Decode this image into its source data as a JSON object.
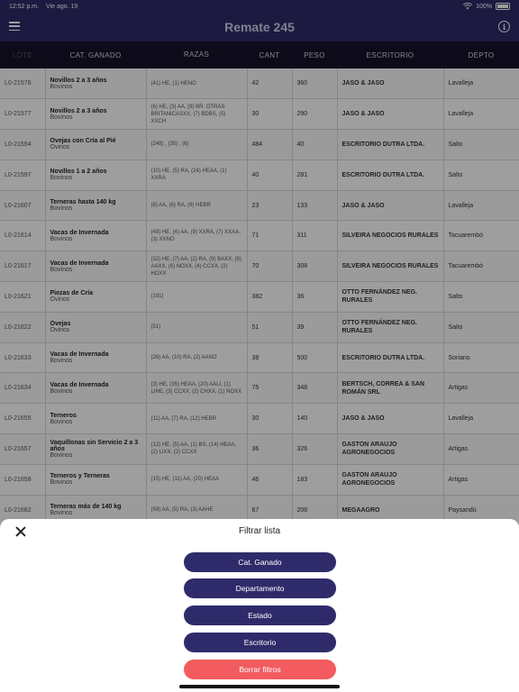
{
  "status": {
    "time": "12:52 p.m.",
    "date": "Vie ago. 19",
    "battery": "100%"
  },
  "header": {
    "title": "Remate 245"
  },
  "table": {
    "columns": [
      "LOTE",
      "CAT. GANADO",
      "RAZAS",
      "CANT",
      "PESO",
      "ESCRITORIO",
      "DEPTO"
    ],
    "rows": [
      {
        "lote": "L0-21576",
        "cat": "Novillos 2 a 3 años",
        "tipo": "Bovinos",
        "razas": "(41) HE, (1) HENO",
        "cant": "42",
        "peso": "360",
        "escritorio": "JASO & JASO",
        "depto": "Lavalleja"
      },
      {
        "lote": "L0-21577",
        "cat": "Novillos 2 a 3 años",
        "tipo": "Bovinos",
        "razas": "(6) HE, (3) AA, (9) BR: OTRAS BRITANICASXX, (7) BDBS, (5) XXCH",
        "cant": "30",
        "peso": "290",
        "escritorio": "JASO & JASO",
        "depto": "Lavalleja"
      },
      {
        "lote": "L0-21594",
        "cat": "Ovejas con Cría al Pié",
        "tipo": "Ovinos",
        "razas": "(248) , (35) , (6)",
        "cant": "484",
        "peso": "40",
        "escritorio": "ESCRITORIO DUTRA LTDA.",
        "depto": "Salto"
      },
      {
        "lote": "L0-21597",
        "cat": "Novillos 1 a 2 años",
        "tipo": "Bovinos",
        "razas": "(10) HE, (5) RA, (24) HEAA, (1) XXRA",
        "cant": "40",
        "peso": "281",
        "escritorio": "ESCRITORIO DUTRA LTDA.",
        "depto": "Salto"
      },
      {
        "lote": "L0-21607",
        "cat": "Terneras hasta 140 kg",
        "tipo": "Bovinos",
        "razas": "(8) AA, (6) RA, (9) HEBR",
        "cant": "23",
        "peso": "133",
        "escritorio": "JASO & JASO",
        "depto": "Lavalleja"
      },
      {
        "lote": "L0-21614",
        "cat": "Vacas de Invernada",
        "tipo": "Bovinos",
        "razas": "(48) HE, (4) AA, (9) XXRA, (7) XXAA, (3) XXNO",
        "cant": "71",
        "peso": "311",
        "escritorio": "SILVEIRA NEGOCIOS RURALES",
        "depto": "Tacuarembó"
      },
      {
        "lote": "L0-21617",
        "cat": "Vacas de Invernada",
        "tipo": "Bovinos",
        "razas": "(32) HE, (7) AA, (2) RA, (9) BAXX, (8) AAXX, (6) NOXX, (4) CCXX, (2) HOXX",
        "cant": "70",
        "peso": "308",
        "escritorio": "SILVEIRA NEGOCIOS RURALES",
        "depto": "Tacuarembó"
      },
      {
        "lote": "L0-21621",
        "cat": "Piezas de Cría",
        "tipo": "Ovinos",
        "razas": "(191)",
        "cant": "382",
        "peso": "36",
        "escritorio": "OTTO FERNÁNDEZ NEG. RURALES",
        "depto": "Salto"
      },
      {
        "lote": "L0-21622",
        "cat": "Ovejas",
        "tipo": "Ovinos",
        "razas": "(51)",
        "cant": "51",
        "peso": "39",
        "escritorio": "OTTO FERNÁNDEZ NEG. RURALES",
        "depto": "Salto"
      },
      {
        "lote": "L0-21633",
        "cat": "Vacas de Invernada",
        "tipo": "Bovinos",
        "razas": "(26) AA, (10) RA, (2) AANO",
        "cant": "38",
        "peso": "500",
        "escritorio": "ESCRITORIO DUTRA LTDA.",
        "depto": "Soriano"
      },
      {
        "lote": "L0-21634",
        "cat": "Vacas de Invernada",
        "tipo": "Bovinos",
        "razas": "(3) HE, (35) HEAA, (20) AALI, (1) LIHE, (3) CCXX, (2) CHXX, (1) NOXX",
        "cant": "75",
        "peso": "348",
        "escritorio": "BERTSCH, CORREA & SAN ROMÁN SRL",
        "depto": "Artigas"
      },
      {
        "lote": "L0-21655",
        "cat": "Terneros",
        "tipo": "Bovinos",
        "razas": "(11) AA, (7) RA, (12) HEBR",
        "cant": "30",
        "peso": "140",
        "escritorio": "JASO & JASO",
        "depto": "Lavalleja"
      },
      {
        "lote": "L0-21657",
        "cat": "Vaquillonas sin Servicio 2 a 3 años",
        "tipo": "Bovinos",
        "razas": "(12) HE, (5) AA, (1) BS, (14) HEAA, (2) LIXX, (2) CCXX",
        "cant": "36",
        "peso": "326",
        "escritorio": "GASTON ARAUJO AGRONEGOCIOS",
        "depto": "Artigas"
      },
      {
        "lote": "L0-21658",
        "cat": "Terneros y Terneras",
        "tipo": "Bovinos",
        "razas": "(15) HE, (11) AA, (20) HEAA",
        "cant": "46",
        "peso": "183",
        "escritorio": "GASTON ARAUJO AGRONEGOCIOS",
        "depto": "Artigas"
      },
      {
        "lote": "L0-21682",
        "cat": "Terneras más de 140 kg",
        "tipo": "Bovinos",
        "razas": "(59) AA, (5) RA, (3) AAHE",
        "cant": "67",
        "peso": "208",
        "escritorio": "MEGAAGRO",
        "depto": "Paysandú"
      }
    ]
  },
  "filter_sheet": {
    "title": "Filtrar lista",
    "buttons": [
      "Cat. Ganado",
      "Departamento",
      "Estado",
      "Escritorio"
    ],
    "clear": "Borrar filtros"
  },
  "colors": {
    "primary": "#2f2b6b",
    "header_dark": "#151329",
    "danger": "#f25c61"
  }
}
